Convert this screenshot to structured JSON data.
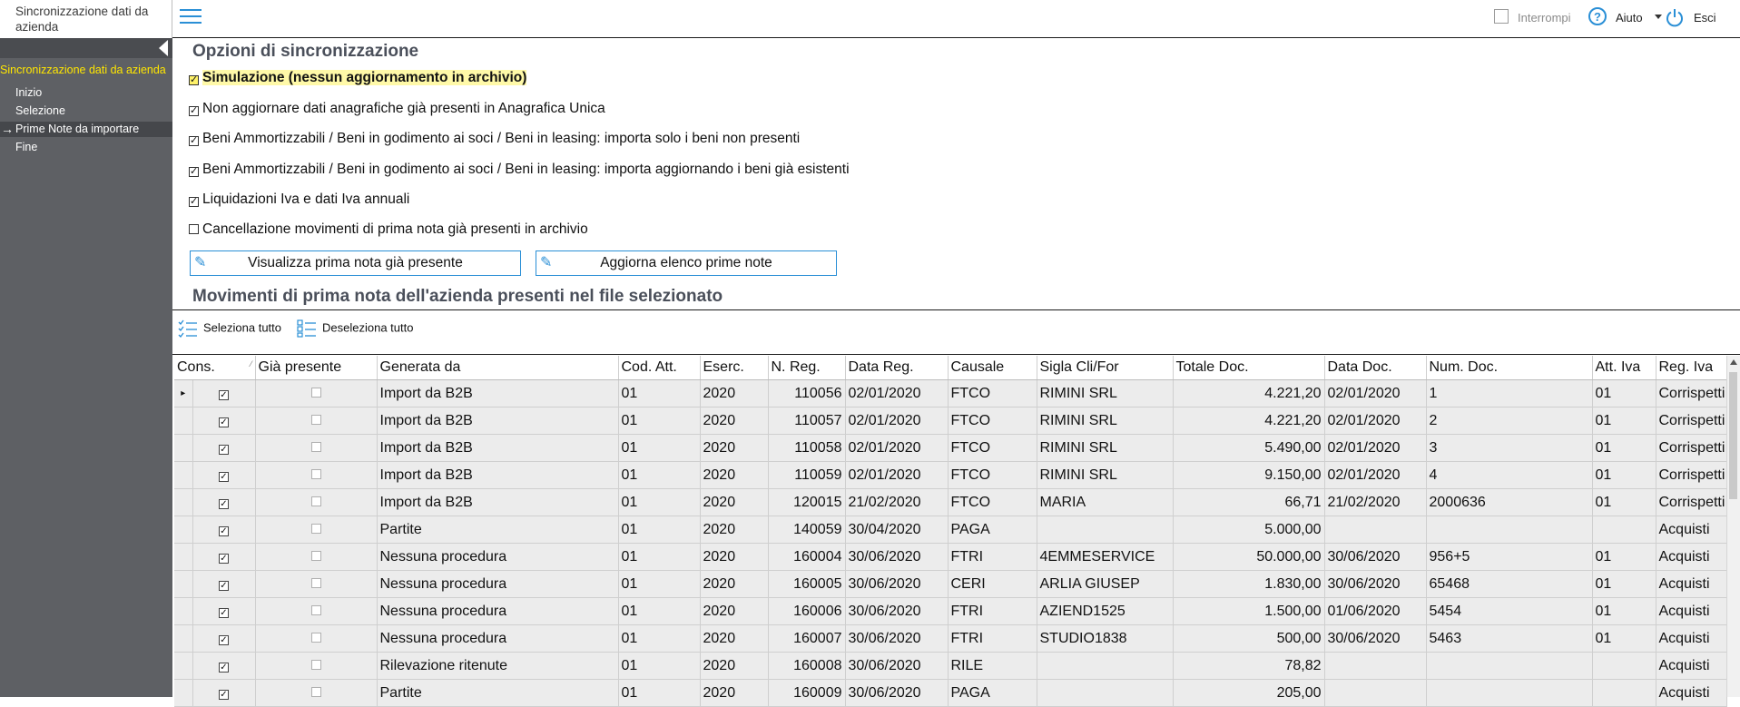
{
  "app": {
    "title": "Sincronizzazione dati da azienda"
  },
  "sidebar": {
    "section": "Sincronizzazione dati da azienda",
    "steps": [
      {
        "label": "Inizio",
        "active": false
      },
      {
        "label": "Selezione",
        "active": false
      },
      {
        "label": "Prime Note da importare",
        "active": true
      },
      {
        "label": "Fine",
        "active": false
      }
    ]
  },
  "topbar": {
    "interrompi_label": "Interrompi",
    "help_label": "Aiuto",
    "exit_label": "Esci"
  },
  "options": {
    "title": "Opzioni di sincronizzazione",
    "items": [
      {
        "label": "Simulazione (nessun aggiornamento in archivio)",
        "checked": true
      },
      {
        "label": "Non aggiornare dati anagrafiche già presenti in Anagrafica Unica",
        "checked": true
      },
      {
        "label": "Beni Ammortizzabili / Beni in godimento ai soci / Beni in leasing: importa solo i beni non presenti",
        "checked": true
      },
      {
        "label": "Beni Ammortizzabili / Beni in godimento ai soci / Beni in leasing: importa aggiornando i beni già esistenti",
        "checked": true
      },
      {
        "label": "Liquidazioni Iva e dati Iva annuali",
        "checked": true
      },
      {
        "label": "Cancellazione movimenti di prima nota già presenti in archivio",
        "checked": false
      }
    ],
    "btn_view": "Visualizza prima nota già presente",
    "btn_update": "Aggiorna elenco prime note"
  },
  "movements": {
    "title": "Movimenti di prima nota dell'azienda presenti nel file selezionato",
    "select_all": "Seleziona tutto",
    "deselect_all": "Deseleziona tutto",
    "columns": [
      "Cons.",
      "Già presente",
      "Generata da",
      "Cod. Att.",
      "Eserc.",
      "N. Reg.",
      "Data Reg.",
      "Causale",
      "Sigla Cli/For",
      "Totale Doc.",
      "Data Doc.",
      "Num. Doc.",
      "Att. Iva",
      "Reg. Iva"
    ],
    "rows": [
      [
        "Import da B2B",
        "01",
        "2020",
        "110056",
        "02/01/2020",
        "FTCO",
        "RIMINI SRL",
        "4.221,20",
        "02/01/2020",
        "1",
        "01",
        "Corrispetti"
      ],
      [
        "Import da B2B",
        "01",
        "2020",
        "110057",
        "02/01/2020",
        "FTCO",
        "RIMINI SRL",
        "4.221,20",
        "02/01/2020",
        "2",
        "01",
        "Corrispetti"
      ],
      [
        "Import da B2B",
        "01",
        "2020",
        "110058",
        "02/01/2020",
        "FTCO",
        "RIMINI SRL",
        "5.490,00",
        "02/01/2020",
        "3",
        "01",
        "Corrispetti"
      ],
      [
        "Import da B2B",
        "01",
        "2020",
        "110059",
        "02/01/2020",
        "FTCO",
        "RIMINI SRL",
        "9.150,00",
        "02/01/2020",
        "4",
        "01",
        "Corrispetti"
      ],
      [
        "Import da B2B",
        "01",
        "2020",
        "120015",
        "21/02/2020",
        "FTCO",
        "MARIA",
        "66,71",
        "21/02/2020",
        "2000636",
        "01",
        "Corrispetti"
      ],
      [
        "Partite",
        "01",
        "2020",
        "140059",
        "30/04/2020",
        "PAGA",
        "",
        "5.000,00",
        "",
        "",
        "",
        "Acquisti"
      ],
      [
        "Nessuna procedura",
        "01",
        "2020",
        "160004",
        "30/06/2020",
        "FTRI",
        "4EMMESERVICE",
        "50.000,00",
        "30/06/2020",
        "956+5",
        "01",
        "Acquisti"
      ],
      [
        "Nessuna procedura",
        "01",
        "2020",
        "160005",
        "30/06/2020",
        "CERI",
        "ARLIA GIUSEP",
        "1.830,00",
        "30/06/2020",
        "65468",
        "01",
        "Acquisti"
      ],
      [
        "Nessuna procedura",
        "01",
        "2020",
        "160006",
        "30/06/2020",
        "FTRI",
        "AZIEND1525",
        "1.500,00",
        "01/06/2020",
        "5454",
        "01",
        "Acquisti"
      ],
      [
        "Nessuna procedura",
        "01",
        "2020",
        "160007",
        "30/06/2020",
        "FTRI",
        "STUDIO1838",
        "500,00",
        "30/06/2020",
        "5463",
        "01",
        "Acquisti"
      ],
      [
        "Rilevazione ritenute",
        "01",
        "2020",
        "160008",
        "30/06/2020",
        "RILE",
        "",
        "78,82",
        "",
        "",
        "",
        "Acquisti"
      ],
      [
        "Partite",
        "01",
        "2020",
        "160009",
        "30/06/2020",
        "PAGA",
        "",
        "205,00",
        "",
        "",
        "",
        "Acquisti"
      ]
    ]
  },
  "colors": {
    "accent": "#2a8fd6",
    "sidebar_bg": "#5e6064",
    "sidebar_section": "#ffe600",
    "row_bg": "#ececec"
  }
}
